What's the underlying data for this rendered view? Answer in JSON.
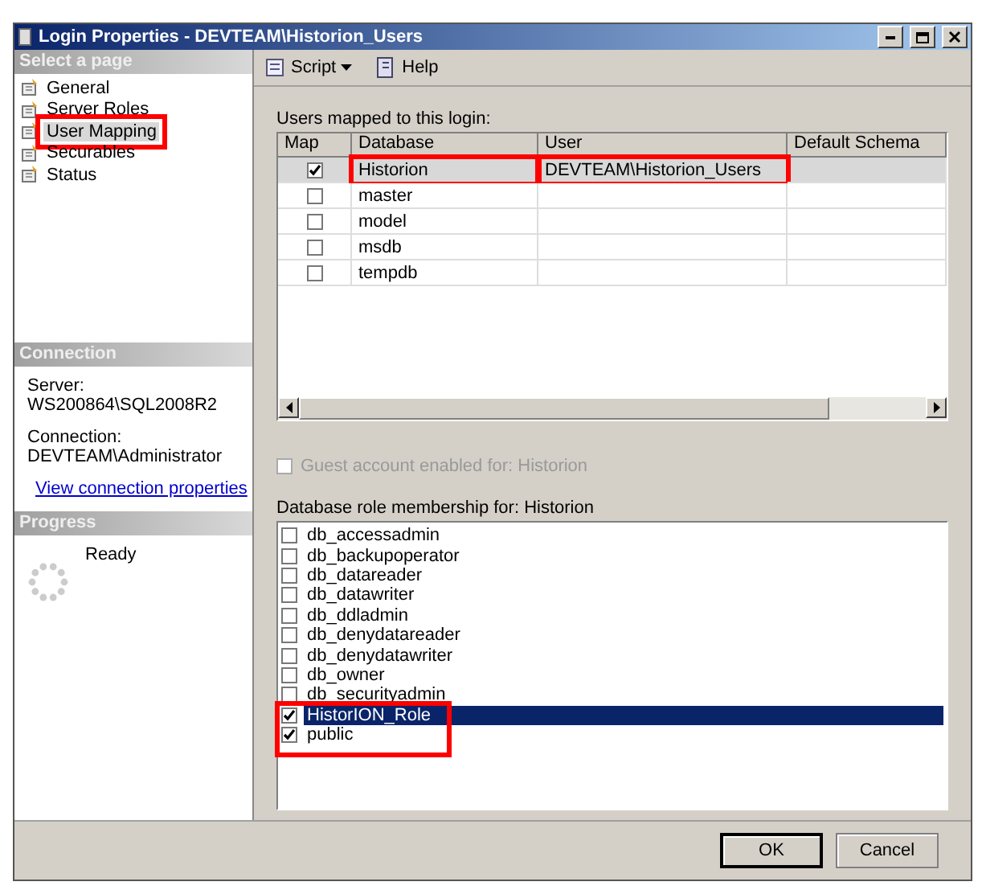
{
  "window": {
    "title": "Login Properties - DEVTEAM\\Historion_Users"
  },
  "sidebar": {
    "header": "Select a page",
    "items": [
      {
        "label": "General",
        "selected": false,
        "annotated": false
      },
      {
        "label": "Server Roles",
        "selected": false,
        "annotated": false
      },
      {
        "label": "User Mapping",
        "selected": true,
        "annotated": true
      },
      {
        "label": "Securables",
        "selected": false,
        "annotated": false
      },
      {
        "label": "Status",
        "selected": false,
        "annotated": false
      }
    ]
  },
  "connection": {
    "header": "Connection",
    "server_label": "Server:",
    "server": "WS200864\\SQL2008R2",
    "connection_label": "Connection:",
    "connection": "DEVTEAM\\Administrator",
    "link": "View connection properties"
  },
  "progress": {
    "header": "Progress",
    "status": "Ready"
  },
  "toolbar": {
    "script": "Script",
    "help": "Help"
  },
  "mapping": {
    "label": "Users mapped to this login:",
    "columns": [
      "Map",
      "Database",
      "User",
      "Default Schema"
    ],
    "rows": [
      {
        "map": true,
        "database": "Historion",
        "user": "DEVTEAM\\Historion_Users",
        "selected": true,
        "annotated": true
      },
      {
        "map": false,
        "database": "master",
        "selected": false,
        "annotated": false
      },
      {
        "map": false,
        "database": "model",
        "selected": false,
        "annotated": false
      },
      {
        "map": false,
        "database": "msdb",
        "selected": false,
        "annotated": false
      },
      {
        "map": false,
        "database": "tempdb",
        "selected": false,
        "annotated": false
      }
    ]
  },
  "guest": {
    "label": "Guest account enabled for: Historion",
    "checked": false,
    "disabled": true
  },
  "roles": {
    "label": "Database role membership for: Historion",
    "items": [
      {
        "name": "db_accessadmin",
        "checked": false,
        "selected": false,
        "annotated": false
      },
      {
        "name": "db_backupoperator",
        "checked": false,
        "selected": false,
        "annotated": false
      },
      {
        "name": "db_datareader",
        "checked": false,
        "selected": false,
        "annotated": false
      },
      {
        "name": "db_datawriter",
        "checked": false,
        "selected": false,
        "annotated": false
      },
      {
        "name": "db_ddladmin",
        "checked": false,
        "selected": false,
        "annotated": false
      },
      {
        "name": "db_denydatareader",
        "checked": false,
        "selected": false,
        "annotated": false
      },
      {
        "name": "db_denydatawriter",
        "checked": false,
        "selected": false,
        "annotated": false
      },
      {
        "name": "db_owner",
        "checked": false,
        "selected": false,
        "annotated": false
      },
      {
        "name": "db_securityadmin",
        "checked": false,
        "selected": false,
        "annotated": false
      },
      {
        "name": "HistorION_Role",
        "checked": true,
        "selected": true,
        "annotated": true
      },
      {
        "name": "public",
        "checked": true,
        "selected": false,
        "annotated": true
      }
    ]
  },
  "buttons": [
    {
      "label": "OK",
      "kind": "default"
    },
    {
      "label": "Cancel",
      "kind": "normal"
    }
  ]
}
